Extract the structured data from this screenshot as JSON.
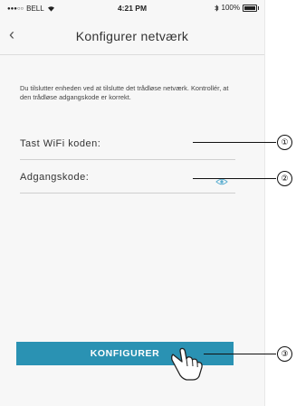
{
  "status_bar": {
    "carrier": "BELL",
    "time": "4:21 PM",
    "battery": "100%"
  },
  "nav": {
    "back_icon": "chevron-left-icon",
    "title": "Konfigurer netværk"
  },
  "instructions": "Du tilslutter enheden ved at tilslutte det trådløse netværk. Kontrollér, at den trådløse adgangskode er korrekt.",
  "fields": {
    "wifi_label": "Tast WiFi koden:",
    "password_label": "Adgangskode:",
    "password_icon": "eye-icon"
  },
  "button": {
    "label": "KONFIGURER"
  },
  "callouts": [
    "①",
    "②",
    "③"
  ],
  "colors": {
    "accent": "#2a92b3",
    "eye_icon": "#5aaed0"
  }
}
